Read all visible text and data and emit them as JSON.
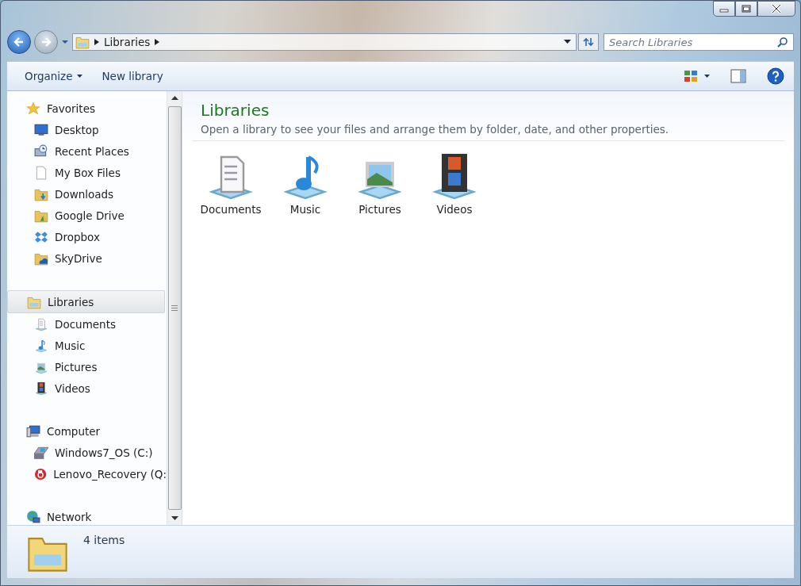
{
  "address_bar": {
    "crumbs": [
      "Libraries"
    ]
  },
  "search": {
    "placeholder": "Search Libraries"
  },
  "toolbar": {
    "commands": [
      {
        "label": "Organize",
        "dropdown": true
      },
      {
        "label": "New library",
        "dropdown": false
      }
    ]
  },
  "navigation": [
    {
      "label": "Favorites",
      "kind": "star",
      "selected": false,
      "children": [
        {
          "label": "Desktop",
          "kind": "desktop",
          "selected": false
        },
        {
          "label": "Recent Places",
          "kind": "recent",
          "selected": false
        },
        {
          "label": "My Box Files",
          "kind": "file",
          "selected": false
        },
        {
          "label": "Downloads",
          "kind": "downloads",
          "selected": false
        },
        {
          "label": "Google Drive",
          "kind": "gdrive",
          "selected": false
        },
        {
          "label": "Dropbox",
          "kind": "dropbox",
          "selected": false
        },
        {
          "label": "SkyDrive",
          "kind": "skydrive",
          "selected": false
        }
      ]
    },
    {
      "label": "Libraries",
      "kind": "libraries",
      "selected": true,
      "children": [
        {
          "label": "Documents",
          "kind": "documents",
          "selected": false
        },
        {
          "label": "Music",
          "kind": "music",
          "selected": false
        },
        {
          "label": "Pictures",
          "kind": "pictures",
          "selected": false
        },
        {
          "label": "Videos",
          "kind": "videos",
          "selected": false
        }
      ]
    },
    {
      "label": "Computer",
      "kind": "computer",
      "selected": false,
      "children": [
        {
          "label": "Windows7_OS (C:)",
          "kind": "drive",
          "selected": false
        },
        {
          "label": "Lenovo_Recovery (Q:",
          "kind": "recovery",
          "selected": false
        }
      ]
    },
    {
      "label": "Network",
      "kind": "network",
      "selected": false
    }
  ],
  "content": {
    "title": "Libraries",
    "description": "Open a library to see your files and arrange them by folder, date, and other properties.",
    "items": [
      {
        "label": "Documents",
        "kind": "documents"
      },
      {
        "label": "Music",
        "kind": "music"
      },
      {
        "label": "Pictures",
        "kind": "pictures"
      },
      {
        "label": "Videos",
        "kind": "videos"
      }
    ]
  },
  "status_bar": {
    "text": "4 items"
  }
}
